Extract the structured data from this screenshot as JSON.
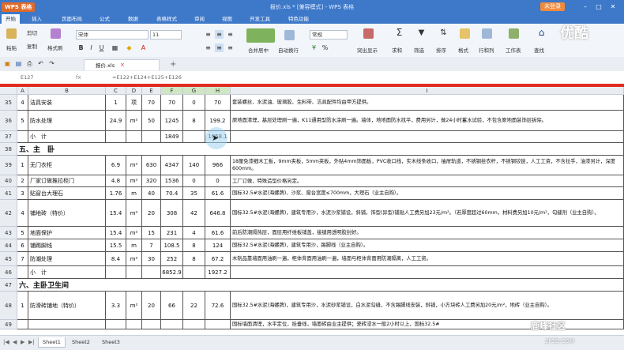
{
  "titlebar": {
    "app_name": "WPS 表格",
    "doc_title": "报价.xls * [兼容模式] - WPS 表格",
    "login_label": "未登录",
    "min": "–",
    "max": "□",
    "close": "✕"
  },
  "menu": [
    "开始",
    "插入",
    "页面布局",
    "公式",
    "数据",
    "表格样式",
    "审阅",
    "视图",
    "开发工具",
    "特色功能"
  ],
  "ribbon": {
    "cut": "剪切",
    "paste": "粘贴",
    "copy": "复制",
    "format_painter": "格式刷",
    "font_name": "宋体",
    "font_size": "11",
    "merge_center": "合并居中",
    "wrap_text": "自动换行",
    "number_format": "常规",
    "conditional_format": "突出显示",
    "sum": "求和",
    "filter": "筛选",
    "sort": "排序",
    "format": "格式",
    "row_col": "行和列",
    "worksheet": "工作表",
    "find": "查找"
  },
  "watermark": "优酷",
  "tab": {
    "file_name": "报价.xls",
    "close": "×",
    "add": "+"
  },
  "formulabar": {
    "name_box": "E127",
    "fx": "fx",
    "formula": "=E122+E124+E125+E126"
  },
  "columns": [
    "A",
    "B",
    "C",
    "D",
    "E",
    "F",
    "G",
    "H",
    "I"
  ],
  "rows": [
    {
      "rownum": "35",
      "a": "4",
      "b": "洁具安装",
      "c": "1",
      "d": "项",
      "e": "70",
      "f": "70",
      "g": "0",
      "h": "70",
      "i": "套装螺丝、水泥油、玻璃胶、生料带、洁具配件均由甲方提供。"
    },
    {
      "rownum": "36",
      "a": "5",
      "b": "防水处理",
      "c": "24.9",
      "d": "m²",
      "e": "50",
      "f": "1245",
      "g": "8",
      "h": "199.2",
      "i": "原地面清理，基层处理刷一遍，K11通用型防水涂刷一遍。墙体，地地面防水找平，费用另计，做24小时蓄水试验，不包含原地面装饰层拆除。"
    },
    {
      "rownum": "37",
      "a": "",
      "b": "小　计",
      "c": "",
      "d": "",
      "e": "",
      "f": "1849",
      "g": "",
      "h": "1058.1",
      "i": ""
    },
    {
      "rownum": "38",
      "section": "五、主　卧"
    },
    {
      "rownum": "39",
      "a": "1",
      "b": "无门衣柜",
      "c": "6.9",
      "d": "m²",
      "e": "630",
      "f": "4347",
      "g": "140",
      "h": "966",
      "i": "18厘免漆细木工板，9mm夹板，5mm夹板，外贴4mm饰面板，PVC收口线，实木线条收口，抽屉轨道，不锈钢挂衣杆，不锈钢铰链，人工工资，不含拉手，油漆另计，深度600mm。"
    },
    {
      "rownum": "40",
      "a": "2",
      "b": "厂家订做推拉柜门",
      "c": "4.8",
      "d": "m²",
      "e": "320",
      "f": "1536",
      "g": "0",
      "h": "0",
      "i": "工厂订做，特殊造型价格另定。"
    },
    {
      "rownum": "41",
      "a": "3",
      "b": "贴窗台大理石",
      "c": "1.76",
      "d": "m",
      "e": "40",
      "f": "70.4",
      "g": "35",
      "h": "61.6",
      "i": "国标32.5#水泥(海螺牌)、沙浆、窗台宽度≤700mm，大理石（业主自购）。"
    },
    {
      "rownum": "42",
      "a": "4",
      "b": "铺地砖（特价）",
      "c": "15.4",
      "d": "m²",
      "e": "20",
      "f": "308",
      "g": "42",
      "h": "646.8",
      "i": "国标32.5#水泥(海螺牌)，建筑专用沙，水泥沙浆铺设，斜铺，饰型(异型)铺贴人工费另加23元/m²。（若厚度超过60mm，材料费另加10元/m²，勾缝剂（业主自购）。"
    },
    {
      "rownum": "43",
      "a": "5",
      "b": "地面保护",
      "c": "15.4",
      "d": "m²",
      "e": "15",
      "f": "231",
      "g": "4",
      "h": "61.6",
      "i": "前后防潮隔热层，面层用纤维板铺盖，接缝用透明胶封好。"
    },
    {
      "rownum": "44",
      "a": "6",
      "b": "铺踢脚线",
      "c": "15.5",
      "d": "m",
      "e": "7",
      "f": "108.5",
      "g": "8",
      "h": "124",
      "i": "国标32.5#水泥(海螺牌)，建筑专用沙，踢脚线（业主自购）。"
    },
    {
      "rownum": "45",
      "a": "7",
      "b": "防潮处理",
      "c": "8.4",
      "d": "m²",
      "e": "30",
      "f": "252",
      "g": "8",
      "h": "67.2",
      "i": "木制品靠墙面用油刷一遍，柜体背面用油刷一遍，墙面与柜体背面用防潮隔离，人工工资。"
    },
    {
      "rownum": "46",
      "a": "",
      "b": "小　计",
      "c": "",
      "d": "",
      "e": "",
      "f": "6852.9",
      "g": "",
      "h": "1927.2",
      "i": ""
    },
    {
      "rownum": "47",
      "section": "六、主卧卫生间"
    },
    {
      "rownum": "48",
      "a": "1",
      "b": "防滑砖铺地（特价）",
      "c": "3.3",
      "d": "m²",
      "e": "20",
      "f": "66",
      "g": "22",
      "h": "72.6",
      "i": "国标32.5#水泥(海螺牌)，建筑专用沙，水泥砂浆铺设，白水泥勾缝，不含踢脚线安装，斜铺，小方块砖人工费另加20元/m²，地砖（业主自购）。"
    },
    {
      "rownum": "49",
      "a": "",
      "b": "",
      "c": "",
      "d": "",
      "e": "",
      "f": "",
      "g": "",
      "h": "",
      "i": "国标墙面清理，水平定位，挂垂线，墙面砖由业主提供；瓷砖浸水一般2小时以上，国标32.5#"
    }
  ],
  "sheets": [
    "Sheet1",
    "Sheet2",
    "Sheet3"
  ],
  "nav_glyphs": [
    "|◀",
    "◀",
    "▶",
    "▶|"
  ],
  "bottom_logo": "鹿峰社区",
  "bottom_url": "2F3D.COM"
}
